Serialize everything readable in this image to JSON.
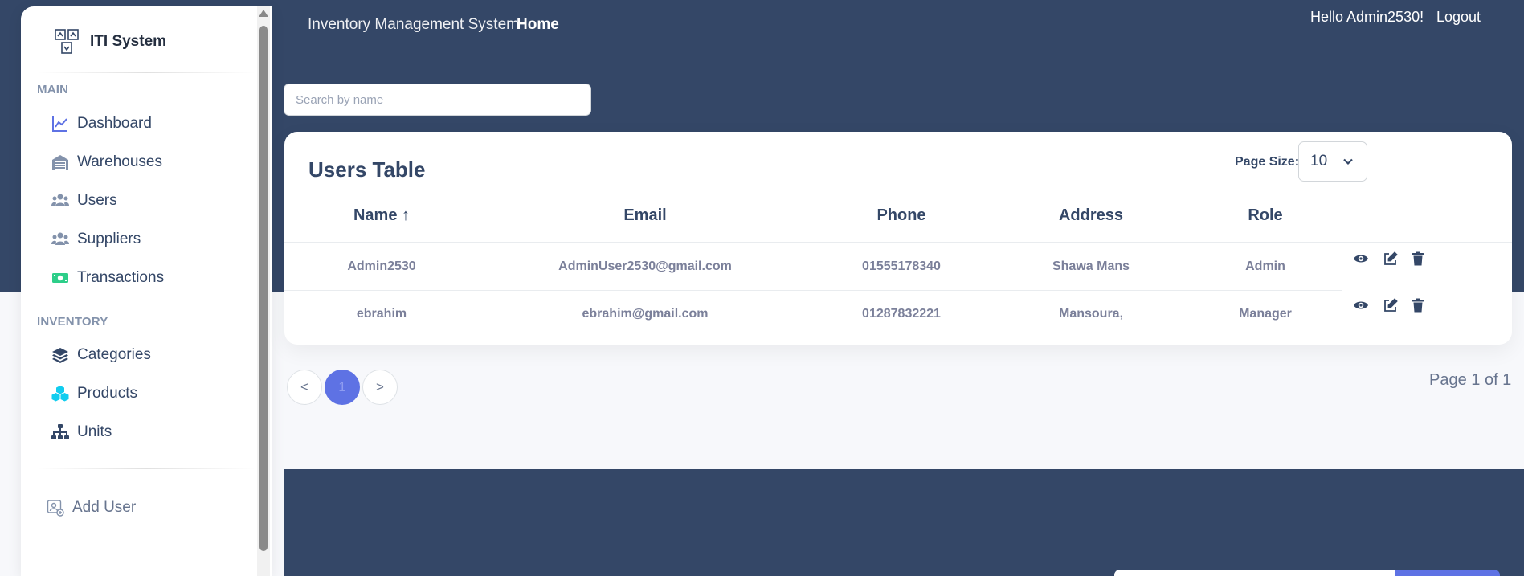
{
  "brand": {
    "name": "ITI System",
    "logo_icon": "boxes-logo-icon"
  },
  "sidebar": {
    "sections": [
      {
        "title": "MAIN",
        "items": [
          {
            "label": "Dashboard",
            "icon": "chart-line-icon",
            "color": "#5e72e4"
          },
          {
            "label": "Warehouses",
            "icon": "warehouse-icon",
            "color": "#8392ab"
          },
          {
            "label": "Users",
            "icon": "users-icon",
            "color": "#8392ab"
          },
          {
            "label": "Suppliers",
            "icon": "users-icon",
            "color": "#8392ab"
          },
          {
            "label": "Transactions",
            "icon": "money-bill-icon",
            "color": "#2dce89"
          }
        ]
      },
      {
        "title": "INVENTORY",
        "items": [
          {
            "label": "Categories",
            "icon": "layers-icon",
            "color": "#344767"
          },
          {
            "label": "Products",
            "icon": "cubes-icon",
            "color": "#11cdef"
          },
          {
            "label": "Units",
            "icon": "sitemap-icon",
            "color": "#344767"
          }
        ]
      }
    ],
    "footer_item": {
      "label": "Add User",
      "icon": "add-user-icon"
    }
  },
  "navbar": {
    "title": "Inventory Management System",
    "home": "Home",
    "greeting": "Hello Admin2530!",
    "logout": "Logout"
  },
  "search": {
    "placeholder": "Search by name",
    "value": ""
  },
  "table": {
    "title": "Users Table",
    "page_size_label": "Page Size:",
    "page_size_value": "10",
    "columns": [
      "Name ↑",
      "Email",
      "Phone",
      "Address",
      "Role"
    ],
    "rows": [
      {
        "name": "Admin2530",
        "email": "AdminUser2530@gmail.com",
        "phone": "01555178340",
        "address": "Shawa Mans",
        "role": "Admin"
      },
      {
        "name": "ebrahim",
        "email": "ebrahim@gmail.com",
        "phone": "01287832221",
        "address": "Mansoura,",
        "role": "Manager"
      }
    ],
    "action_icons": [
      "eye-icon",
      "edit-icon",
      "trash-icon"
    ]
  },
  "pagination": {
    "prev": "<",
    "current": "1",
    "next": ">",
    "info": "Page 1 of 1"
  },
  "colors": {
    "primary": "#344767",
    "accent": "#5e72e4",
    "muted": "#7b809a"
  }
}
